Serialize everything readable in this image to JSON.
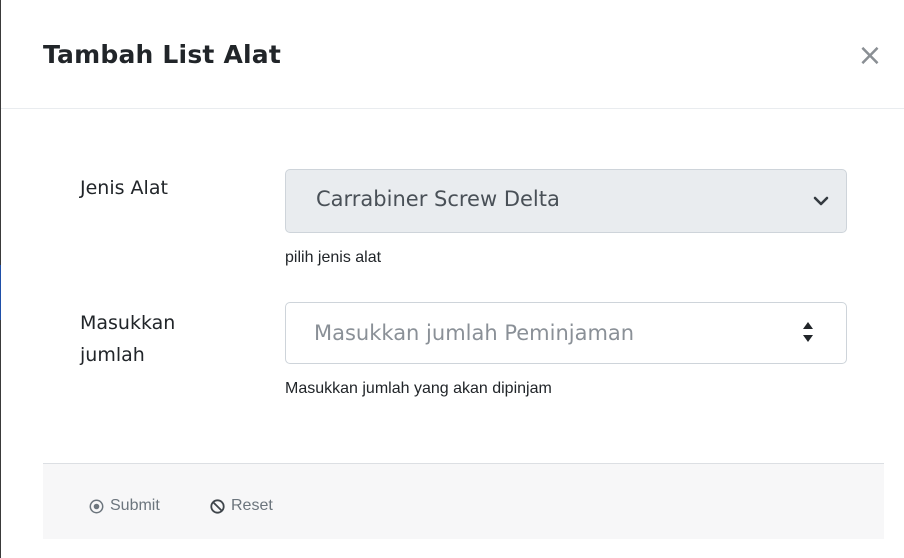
{
  "modal": {
    "title": "Tambah List Alat",
    "close_symbol": "×"
  },
  "form": {
    "jenis_alat": {
      "label": "Jenis Alat",
      "selected_value": "Carrabiner Screw Delta",
      "help_text": "pilih jenis alat",
      "icon": "chevron-down-icon"
    },
    "jumlah": {
      "label_line1": "Masukkan",
      "label_line2": "jumlah",
      "placeholder": "Masukkan jumlah Peminjaman",
      "value": "",
      "help_text": "Masukkan jumlah yang akan dipinjam",
      "icon": "spinner-icon"
    }
  },
  "footer": {
    "submit_label": "Submit",
    "submit_icon": "dot-circle-icon",
    "reset_label": "Reset",
    "reset_icon": "ban-icon"
  }
}
